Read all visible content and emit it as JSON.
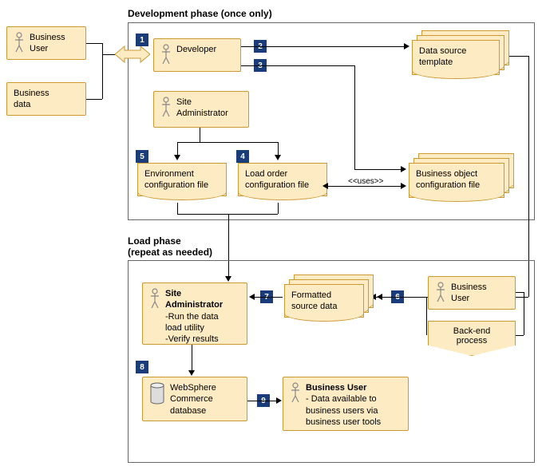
{
  "phase1": {
    "title": "Development phase (once only)"
  },
  "phase2": {
    "title": "Load phase",
    "subtitle": "(repeat as needed)"
  },
  "external": {
    "businessUser": "Business\nUser",
    "businessData": "Business\ndata"
  },
  "dev": {
    "developer": "Developer",
    "siteAdmin": "Site\nAdministrator",
    "dataSourceTemplate": "Data source\ntemplate",
    "envConfig": "Environment\nconfiguration file",
    "loadOrderConfig": "Load order\nconfiguration file",
    "bizObjConfig": "Business object\nconfiguration file",
    "usesLabel": "<<uses>>"
  },
  "load": {
    "siteAdmin": {
      "title": "Site\nAdministrator",
      "line1": "-Run the data",
      "line2": "load utility",
      "line3": "-Verify results"
    },
    "formattedSource": "Formatted\nsource data",
    "businessUser": "Business\nUser",
    "backendProcess": "Back-end\nprocess",
    "db": "WebSphere\nCommerce\ndatabase",
    "finalUser": {
      "title": "Business User",
      "line1": "- Data available to",
      "line2": "business users via",
      "line3": "business user tools"
    }
  },
  "steps": {
    "s1": "1",
    "s2": "2",
    "s3": "3",
    "s4": "4",
    "s5": "5",
    "s6": "6",
    "s7": "7",
    "s8": "8",
    "s9": "9"
  }
}
